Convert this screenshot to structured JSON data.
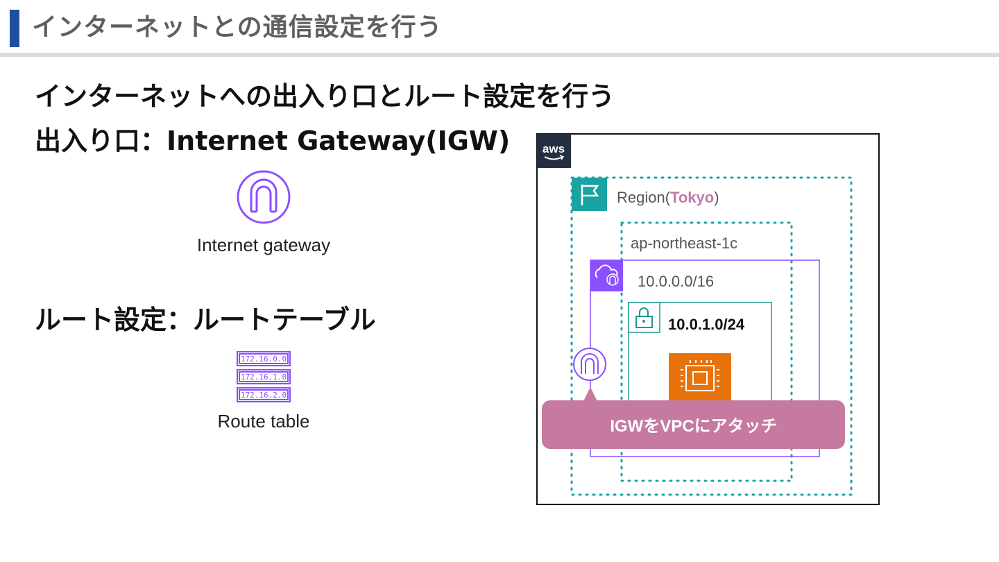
{
  "header": {
    "title": "インターネットとの通信設定を行う"
  },
  "content": {
    "heading_main": "インターネットへの出入り口とルート設定を行う",
    "heading_gateway": "出入り口：Internet Gateway(IGW)",
    "igw_icon_label": "Internet gateway",
    "heading_route": "ルート設定：ルートテーブル",
    "route_table": {
      "entries": [
        "172.16.0.0",
        "172.16.1.0",
        "172.16.2.0"
      ],
      "label": "Route table"
    }
  },
  "diagram": {
    "aws_logo": "aws",
    "region_prefix": "Region(",
    "region_name": "Tokyo",
    "region_suffix": ")",
    "availability_zone": "ap-northeast-1c",
    "vpc_cidr": "10.0.0.0/16",
    "subnet_cidr": "10.0.1.0/24",
    "callout": "IGWをVPCにアタッチ",
    "colors": {
      "title_accent": "#1f4fa0",
      "region_teal": "#1aa3a3",
      "vpc_purple": "#8c4fff",
      "subnet_teal": "#1a9a8f",
      "ec2_orange": "#e8730d",
      "callout": "#c67aa1",
      "region_highlight": "#c07aa8"
    }
  }
}
